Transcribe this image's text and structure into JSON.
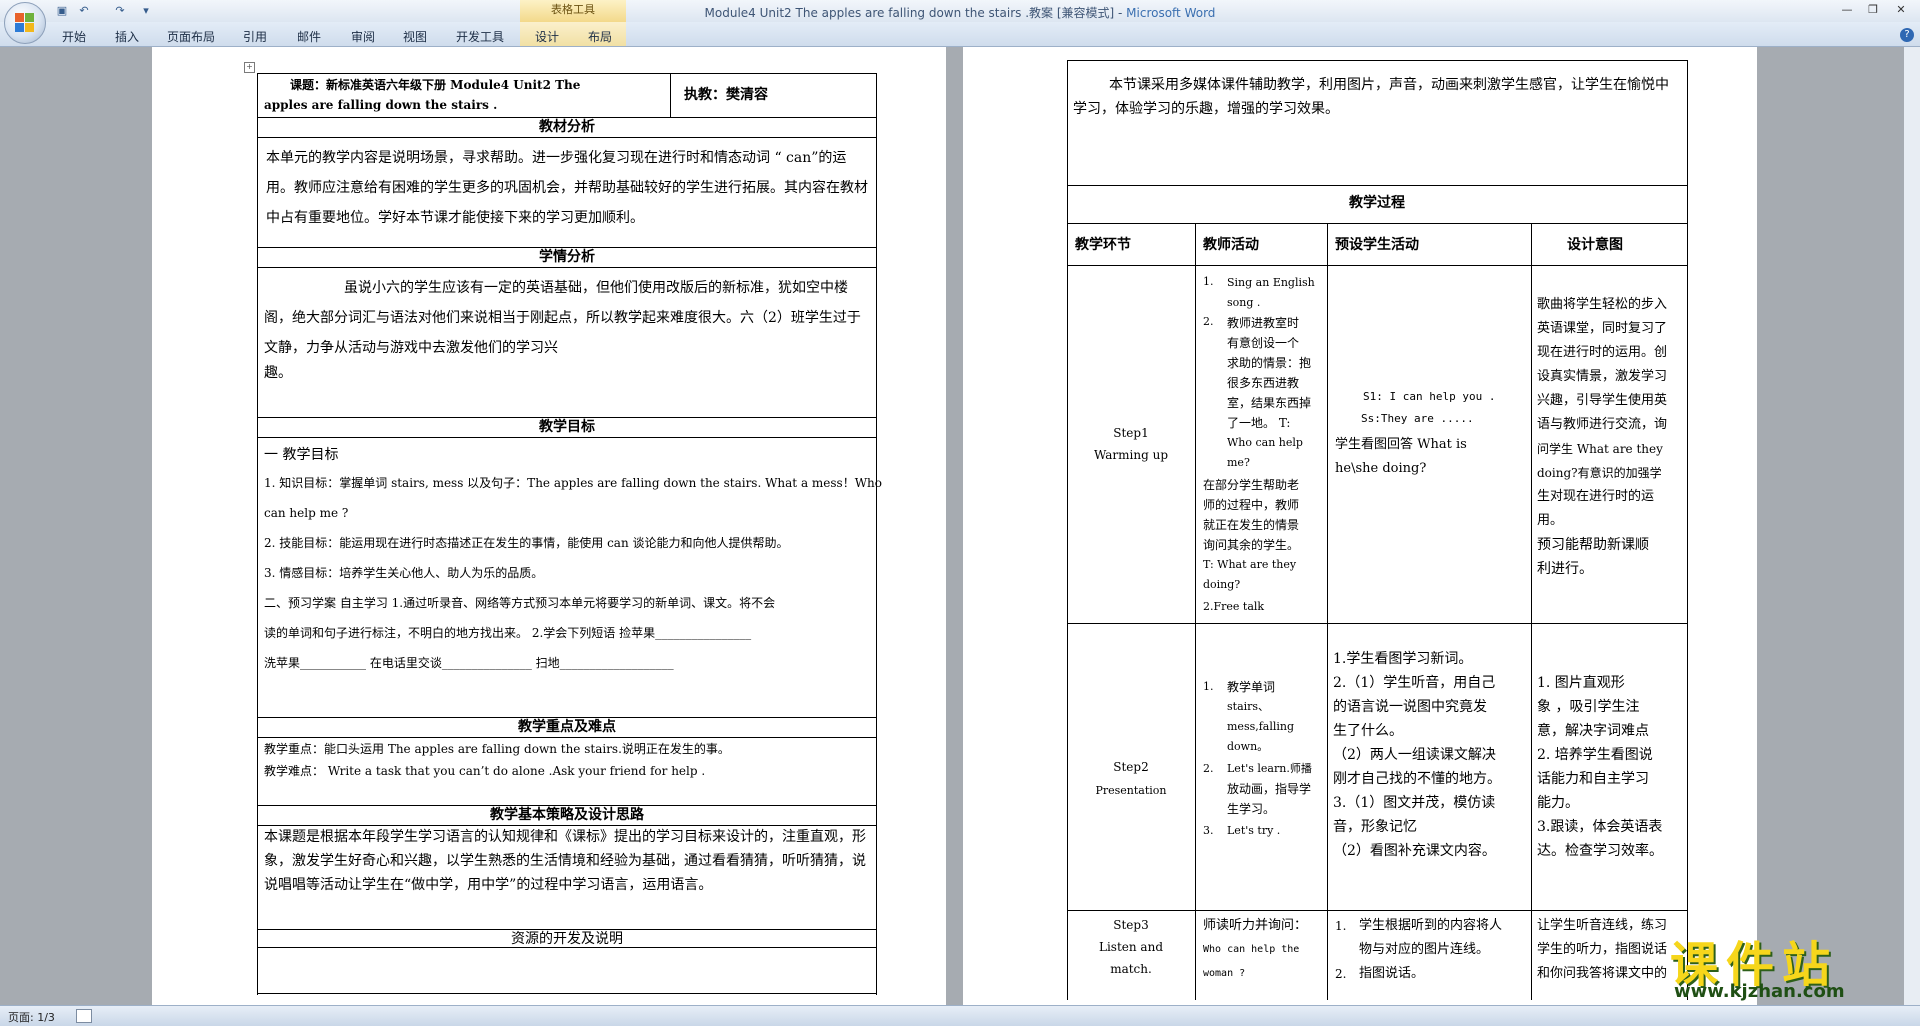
{
  "titlebar": {
    "title": "Module4 Unit2 The apples are falling down the stairs .教案 [兼容模式] - ",
    "app": "Microsoft Word",
    "table_tools": "表格工具"
  },
  "ribbon": {
    "tabs": [
      "开始",
      "插入",
      "页面布局",
      "引用",
      "邮件",
      "审阅",
      "视图",
      "开发工具",
      "设计",
      "布局"
    ]
  },
  "status": {
    "page": "页面: 1/3"
  },
  "left": {
    "header_left_1": "课题：新标准英语六年级下册 Module4 Unit2 The",
    "header_left_2": "apples are falling down the stairs .",
    "header_right": "执教：樊清容",
    "s1_title": "教材分析",
    "s1_body": "本单元的教学内容是说明场景，寻求帮助。进一步强化复习现在进行时和情态动词 “ can”的运用。教师应注意给有困难的学生更多的巩固机会，并帮助基础较好的学生进行拓展。其内容在教材中占有重要地位。学好本节课才能使接下来的学习更加顺利。",
    "s2_title": "学情分析",
    "s2_body": "虽说小六的学生应该有一定的英语基础，但他们使用改版后的新标准，犹如空中楼阁，绝大部分词汇与语法对他们来说相当于刚起点，所以教学起来难度很大。六（2）班学生过于文静，力争从活动与游戏中去激发他们的学习兴",
    "s2_tail": "趣。",
    "s3_title": "教学目标",
    "s3_lines": [
      "一  教学目标",
      "1.  知识目标：掌握单词 stairs, mess 以及句子：The apples are falling down the stairs. What a mess！Who",
      "can help me ?",
      "2. 技能目标：能运用现在进行时态描述正在发生的事情，能使用 can 谈论能力和向他人提供帮助。",
      "3.  情感目标：培养学生关心他人、助人为乐的品质。",
      "二、预习学案  自主学习    1.通过听录音、网络等方式预习本单元将要学习的新单词、课文。将不会",
      "读的单词和句子进行标注，不明白的地方找出来。 2.学会下列短语    捡苹果________________",
      "洗苹果___________    在电话里交谈_______________    扫地___________________"
    ],
    "s4_title": "教学重点及难点",
    "s4_lines": [
      "教学重点：能口头运用 The apples are falling down the stairs.说明正在发生的事。",
      "教学难点：  Write a task that you can’t do alone .Ask your friend for help ."
    ],
    "s5_title": "教学基本策略及设计思路",
    "s5_body": "本课题是根据本年段学生学习语言的认知规律和《课标》提出的学习目标来设计的，注重直观，形象，激发学生好奇心和兴趣，以学生熟悉的生活情境和经验为基础，通过看看猜猜，听听猜猜，说说唱唱等活动让学生在“做中学，用中学”的过程中学习语言，运用语言。",
    "s6_title": "资源的开发及说明"
  },
  "right": {
    "intro": "本节课采用多媒体课件辅助教学，利用图片，声音，动画来刺激学生感官，让学生在愉悦中学习，体验学习的乐趣，增强的学习效果。",
    "process_title": "教学过程",
    "cols": [
      "教学环节",
      "教师活动",
      "预设学生活动",
      "设计意图"
    ],
    "step1": {
      "name": "Step1",
      "sub": "Warming up",
      "teacher": [
        "1.",
        "Sing an English",
        "song .",
        "2.",
        "教师进教室时",
        "有意创设一个",
        "求助的情景：抱",
        "很多东西进教",
        "室，结果东西掉",
        "了一地。    T:",
        "Who can help",
        "me?",
        "在部分学生帮助老",
        "师的过程中，教师",
        "就正在发生的情景",
        "询问其余的学生。",
        "T: What are they",
        "doing?",
        "2.Free talk"
      ],
      "student": [
        "S1: I can help you .",
        "Ss:They are .....",
        "学生看图回答 What is",
        "he\\she doing?"
      ],
      "intent": [
        "歌曲将学生轻松的步入",
        "英语课堂，同时复习了",
        "现在进行时的运用。创",
        "设真实情景，激发学习",
        "兴趣，引导学生使用英",
        "语与教师进行交流，询",
        "问学生 What are they",
        "doing?有意识的加强学",
        "生对现在进行时的运",
        "用。",
        "预习能帮助新课顺",
        "利进行。"
      ]
    },
    "step2": {
      "name": "Step2",
      "sub": "Presentation",
      "teacher": [
        "1.",
        "教学单词",
        "stairs、",
        "mess,falling",
        "down。",
        "2.",
        "Let's learn.师播",
        "放动画，指导学",
        "生学习。",
        "3.",
        "Let's try ."
      ],
      "student": [
        "1.学生看图学习新词。",
        "2.（1）学生听音，用自己",
        "的语言说一说图中究竟发",
        "生了什么。",
        "（2）两人一组读课文解决",
        "刚才自己找的不懂的地方。",
        "3.（1）图文并茂，模仿读",
        "音，形象记忆",
        "（2）看图补充课文内容。"
      ],
      "intent": [
        "1.  图片直观形",
        "象  ，吸引学生注",
        "意，解决字词难点",
        "2.  培养学生看图说",
        "话能力和自主学习",
        "能力。",
        "3.跟读，体会英语表",
        "达。检查学习效率。"
      ]
    },
    "step3": {
      "name": "Step3",
      "sub1": "Listen and",
      "sub2": "match.",
      "teacher": [
        "师读听力并询问：",
        "Who can help the",
        "woman ?"
      ],
      "student": [
        "1.",
        "学生根据听到的内容将人",
        "物与对应的图片连线。",
        "2.",
        "指图说话。"
      ],
      "intent": [
        "让学生听音连线，练习",
        "学生的听力，指图说话",
        "和你问我答将课文中的"
      ]
    }
  },
  "watermark": {
    "title": "课件站",
    "url": "www.kjzhan.com"
  },
  "colors": {
    "ribbon": "#dbe6f3",
    "doc_bg": "#a6abb1",
    "watermark_yellow": "#f6d61b"
  }
}
